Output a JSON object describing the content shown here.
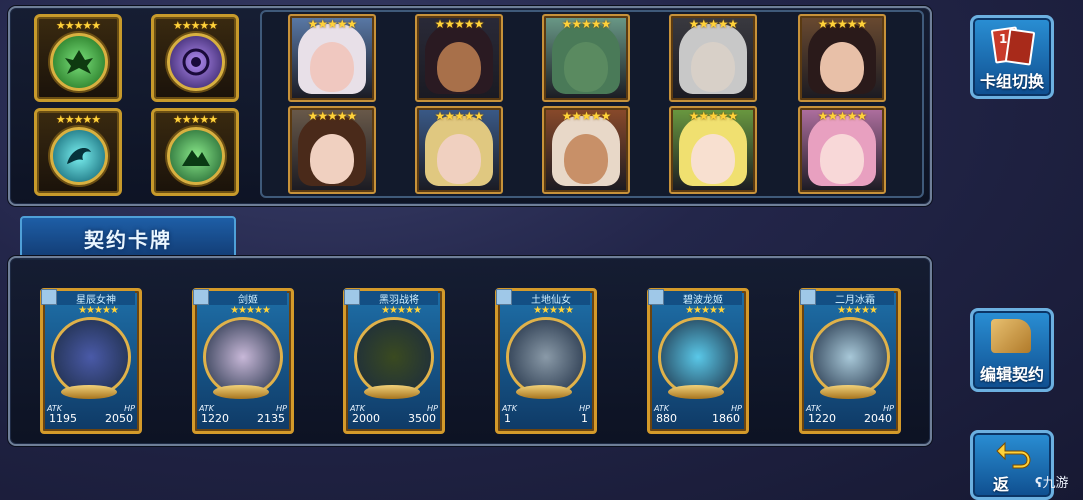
{
  "emblems": [
    {
      "stars": "★★★★★",
      "icon": "eagle-emblem-icon",
      "color": "#3fbf3f"
    },
    {
      "stars": "★★★★★",
      "icon": "purple-sigil-emblem-icon",
      "color": "#7b4fd0"
    },
    {
      "stars": "★★★★★",
      "icon": "dragon-emblem-icon",
      "color": "#2ac0c8"
    },
    {
      "stars": "★★★★★",
      "icon": "mountain-emblem-icon",
      "color": "#3aa84a"
    }
  ],
  "portraits": [
    {
      "stars": "★★★★★",
      "hair": "#e8e0e8",
      "skin": "#f0c8c0",
      "bg": "#5a7aa8"
    },
    {
      "stars": "★★★★★",
      "hair": "#2a1a22",
      "skin": "#a8704a",
      "bg": "#2a2a38"
    },
    {
      "stars": "★★★★★",
      "hair": "#4a7a58",
      "skin": "#5a8a60",
      "bg": "#6a9a88"
    },
    {
      "stars": "★★★★★",
      "hair": "#c8c8c8",
      "skin": "#d8d0c8",
      "bg": "#3a3a40"
    },
    {
      "stars": "★★★★★",
      "hair": "#2a1a1a",
      "skin": "#e8c0a8",
      "bg": "#6a4a30"
    },
    {
      "stars": "★★★★★",
      "hair": "#4a2a1a",
      "skin": "#f0d0c0",
      "bg": "#6a5a4a"
    },
    {
      "stars": "★★★★★",
      "hair": "#e0c880",
      "skin": "#f0d0c0",
      "bg": "#3a5a88"
    },
    {
      "stars": "★★★★★",
      "hair": "#e8d8c8",
      "skin": "#c89068",
      "bg": "#8a4a2a"
    },
    {
      "stars": "★★★★★",
      "hair": "#f0e070",
      "skin": "#f8e0d0",
      "bg": "#6a9a40"
    },
    {
      "stars": "★★★★★",
      "hair": "#e8a0c0",
      "skin": "#f8d8d8",
      "bg": "#b070a0"
    }
  ],
  "section_title": "契约卡牌",
  "cards": [
    {
      "name": "星辰女神",
      "stars": "★★★★★",
      "atk_label": "ATK",
      "hp_label": "HP",
      "atk": "1195",
      "hp": "2050",
      "art": "#4a5aa8"
    },
    {
      "name": "剑姬",
      "stars": "★★★★★",
      "atk_label": "ATK",
      "hp_label": "HP",
      "atk": "1220",
      "hp": "2135",
      "art": "#c8b8d8"
    },
    {
      "name": "黑羽战将",
      "stars": "★★★★★",
      "atk_label": "ATK",
      "hp_label": "HP",
      "atk": "2000",
      "hp": "3500",
      "art": "#3a4a20"
    },
    {
      "name": "土地仙女",
      "stars": "★★★★★",
      "atk_label": "ATK",
      "hp_label": "HP",
      "atk": "1",
      "hp": "1",
      "art": "#8a9aa8"
    },
    {
      "name": "碧波龙姬",
      "stars": "★★★★★",
      "atk_label": "ATK",
      "hp_label": "HP",
      "atk": "880",
      "hp": "1860",
      "art": "#5ac8e8"
    },
    {
      "name": "二月冰霜",
      "stars": "★★★★★",
      "atk_label": "ATK",
      "hp_label": "HP",
      "atk": "1220",
      "hp": "2040",
      "art": "#a8c8d8"
    }
  ],
  "buttons": {
    "switch_deck": "卡组切换",
    "deck_badge": "1",
    "edit_contract": "编辑契约",
    "back": "返"
  },
  "watermark": "九游"
}
